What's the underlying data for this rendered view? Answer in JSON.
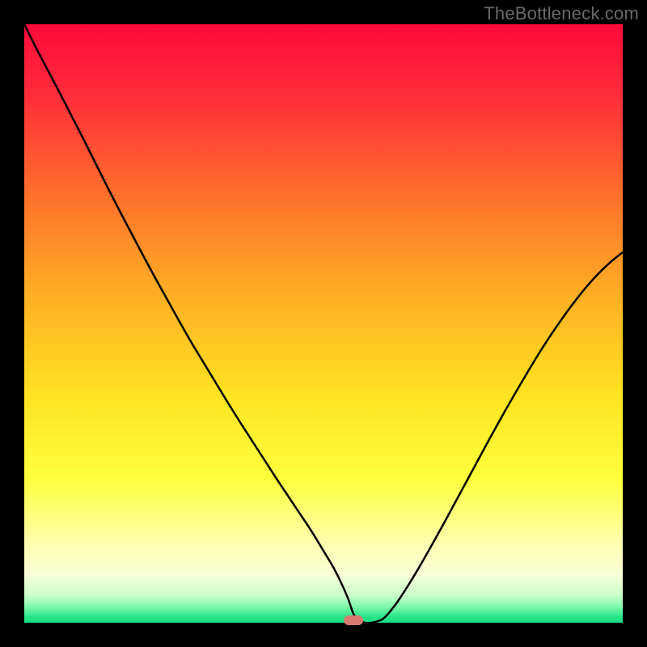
{
  "watermark": "TheBottleneck.com",
  "colors": {
    "frame": "#000000",
    "curve": "#000000",
    "marker": "#d87a70",
    "gradient_stops": [
      {
        "offset": 0.0,
        "color": "#ff0a3a"
      },
      {
        "offset": 0.12,
        "color": "#ff2d3a"
      },
      {
        "offset": 0.28,
        "color": "#ff6d2c"
      },
      {
        "offset": 0.45,
        "color": "#ffae24"
      },
      {
        "offset": 0.62,
        "color": "#ffe322"
      },
      {
        "offset": 0.76,
        "color": "#ffff3c"
      },
      {
        "offset": 0.86,
        "color": "#ffffa8"
      },
      {
        "offset": 0.92,
        "color": "#f7ffd8"
      },
      {
        "offset": 0.955,
        "color": "#c9ffca"
      },
      {
        "offset": 0.975,
        "color": "#76f7a6"
      },
      {
        "offset": 0.99,
        "color": "#27e58a"
      },
      {
        "offset": 1.0,
        "color": "#18db87"
      }
    ]
  },
  "chart_data": {
    "type": "line",
    "title": "",
    "xlabel": "",
    "ylabel": "",
    "xlim": [
      0,
      100
    ],
    "ylim": [
      0,
      100
    ],
    "legend": false,
    "grid": false,
    "marker": {
      "x": 55,
      "y": 0,
      "shape": "rounded-rect",
      "color": "#d87a70"
    },
    "series": [
      {
        "name": "bottleneck-curve",
        "color": "#000000",
        "x": [
          0,
          2,
          4,
          6,
          8,
          10,
          12,
          14,
          16,
          18,
          20,
          22,
          24,
          26,
          28,
          30,
          32,
          34,
          36,
          38,
          40,
          42,
          44,
          46,
          48,
          50,
          52,
          54,
          55,
          56,
          57,
          58,
          60,
          62,
          64,
          66,
          68,
          70,
          72,
          74,
          76,
          78,
          80,
          82,
          84,
          86,
          88,
          90,
          92,
          94,
          96,
          98,
          100
        ],
        "y": [
          100,
          96,
          92.2,
          88.4,
          84.5,
          80.6,
          76.6,
          72.6,
          68.7,
          64.9,
          61.1,
          57.4,
          53.8,
          50.2,
          46.7,
          43.4,
          40.1,
          36.8,
          33.6,
          30.5,
          27.4,
          24.3,
          21.3,
          18.3,
          15.3,
          12.0,
          8.6,
          4.3,
          1.5,
          0.4,
          0.0,
          0.0,
          0.7,
          3.0,
          6.0,
          9.3,
          12.8,
          16.4,
          20.1,
          23.8,
          27.5,
          31.2,
          34.8,
          38.3,
          41.7,
          45.0,
          48.1,
          51.0,
          53.7,
          56.2,
          58.4,
          60.3,
          61.9
        ]
      }
    ]
  }
}
